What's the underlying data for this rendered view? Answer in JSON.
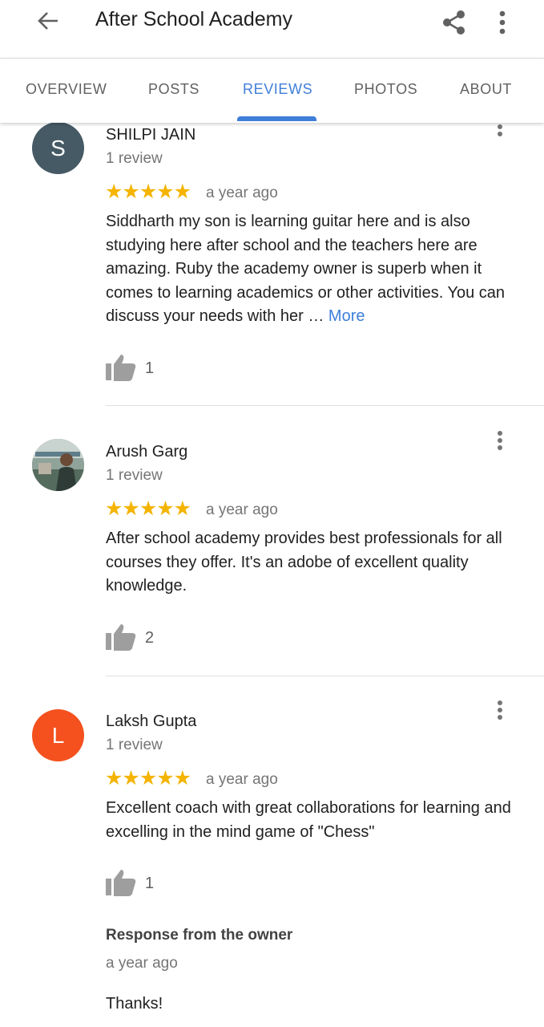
{
  "header": {
    "title": "After School Academy"
  },
  "tabs": [
    {
      "label": "OVERVIEW"
    },
    {
      "label": "POSTS"
    },
    {
      "label": "REVIEWS"
    },
    {
      "label": "PHOTOS"
    },
    {
      "label": "ABOUT"
    }
  ],
  "active_tab": "REVIEWS",
  "colors": {
    "accent": "#3f7fd9",
    "star": "#f4b400",
    "avatar_s": "#455a64",
    "avatar_l": "#f4511e"
  },
  "reviews": [
    {
      "avatar_letter": "S",
      "name": "SHILPI JAIN",
      "review_count": "1 review",
      "stars": "★★★★★",
      "rating": 5,
      "time": "a year ago",
      "text": "Siddharth my son is learning guitar here and is also studying here after school and the teachers here are amazing. Ruby the academy owner is superb when it comes to learning academics or other activities. You can discuss your needs with her …",
      "more_label": "More",
      "likes": "1"
    },
    {
      "avatar_letter": "",
      "name": "Arush Garg",
      "review_count": "1 review",
      "stars": "★★★★★",
      "rating": 5,
      "time": "a year ago",
      "text": "After school academy provides best professionals for all courses they offer. It's an adobe of excellent quality knowledge.",
      "likes": "2"
    },
    {
      "avatar_letter": "L",
      "name": "Laksh Gupta",
      "review_count": "1 review",
      "stars": "★★★★★",
      "rating": 5,
      "time": "a year ago",
      "text": "Excellent coach with great collaborations for learning and excelling in the mind game of \"Chess\"",
      "likes": "1",
      "owner_response": {
        "title": "Response from the owner",
        "time": "a year ago",
        "text": "Thanks!"
      }
    }
  ]
}
